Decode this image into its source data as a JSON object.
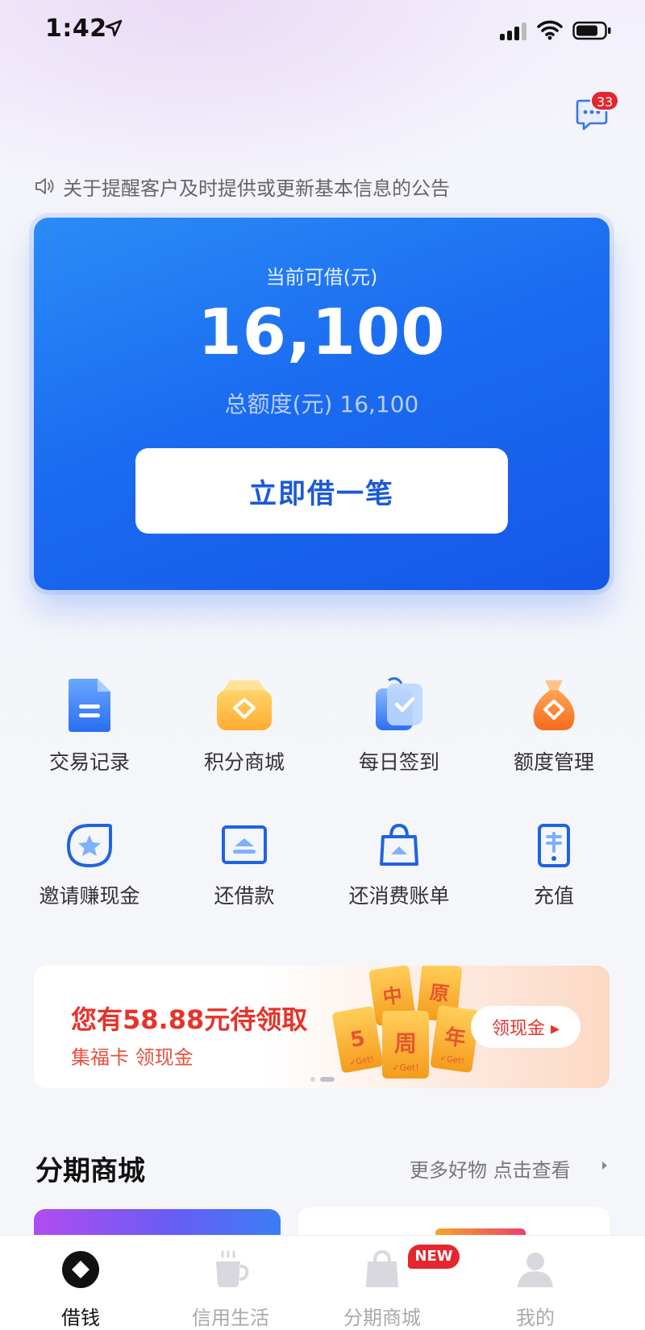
{
  "status_bar": {
    "time": "1:42"
  },
  "messages": {
    "badge_count": "33"
  },
  "notice": {
    "text": "关于提醒客户及时提供或更新基本信息的公告"
  },
  "credit_card": {
    "label": "当前可借(元)",
    "amount": "16,100",
    "total": "总额度(元) 16,100",
    "button": "立即借一笔",
    "colors": {
      "gradient_start": "#2a8cf7",
      "gradient_end": "#1557e8",
      "button_text": "#1b5ad6"
    }
  },
  "grid_row1": [
    {
      "label": "交易记录",
      "icon": "document-icon"
    },
    {
      "label": "积分商城",
      "icon": "points-wallet-icon"
    },
    {
      "label": "每日签到",
      "icon": "checkin-card-icon"
    },
    {
      "label": "额度管理",
      "icon": "money-bag-icon"
    }
  ],
  "grid_row2": [
    {
      "label": "邀请赚现金",
      "icon": "star-badge-icon"
    },
    {
      "label": "还借款",
      "icon": "repay-screen-icon"
    },
    {
      "label": "还消费账单",
      "icon": "shopping-bag-icon"
    },
    {
      "label": "充值",
      "icon": "phone-topup-icon"
    }
  ],
  "banner": {
    "title": "您有58.88元待领取",
    "subtitle": "集福卡 领现金",
    "button": "领现金 ▸",
    "card_chars": [
      "中",
      "原",
      "5",
      "周",
      "年"
    ],
    "card_tag": "✓Get!",
    "page_index": 2,
    "page_count": 2
  },
  "section": {
    "title": "分期商城",
    "more": "更多好物 点击查看"
  },
  "tabbar": {
    "items": [
      {
        "label": "借钱",
        "icon": "coin-icon",
        "active": true
      },
      {
        "label": "信用生活",
        "icon": "coffee-cup-icon",
        "active": false
      },
      {
        "label": "分期商城",
        "icon": "shopping-bag-tab-icon",
        "active": false
      },
      {
        "label": "我的",
        "icon": "profile-icon",
        "active": false
      }
    ],
    "new_badge": "NEW"
  }
}
